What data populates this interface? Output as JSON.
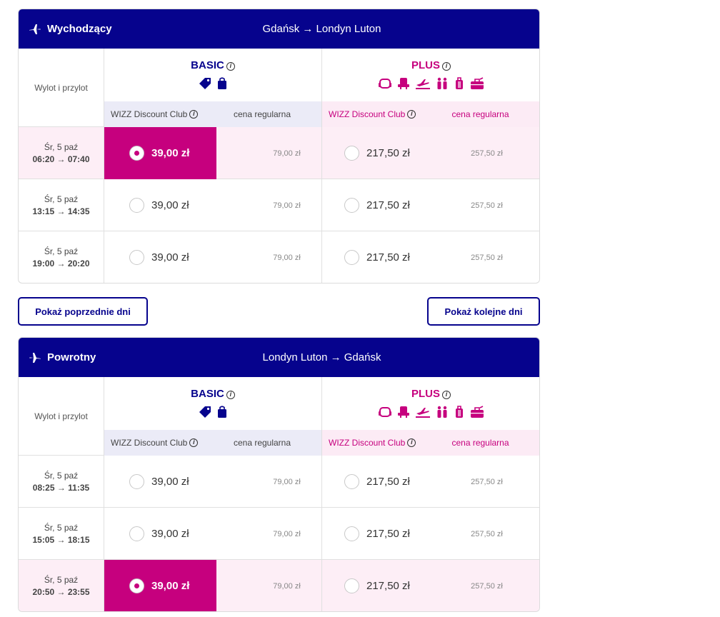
{
  "colors": {
    "brand_blue": "#06038d",
    "brand_pink": "#c6007e",
    "selected_row": "#fdeef6"
  },
  "buttons": {
    "prev_days": "Pokaż poprzednie dni",
    "next_days": "Pokaż kolejne dni"
  },
  "outbound": {
    "direction": "Wychodzący",
    "route": "Gdańsk → Londyn Luton",
    "col_label": "Wylot i przylot",
    "basic": {
      "title": "BASIC",
      "club": "WIZZ Discount Club",
      "regular": "cena regularna"
    },
    "plus": {
      "title": "PLUS",
      "club": "WIZZ Discount Club",
      "regular": "cena regularna"
    },
    "flights": [
      {
        "date": "Śr, 5 paź",
        "time": "06:20 → 07:40",
        "basic_club": "39,00 zł",
        "basic_regular": "79,00 zł",
        "plus_club": "217,50 zł",
        "plus_regular": "257,50 zł",
        "selected": true
      },
      {
        "date": "Śr, 5 paź",
        "time": "13:15 → 14:35",
        "basic_club": "39,00 zł",
        "basic_regular": "79,00 zł",
        "plus_club": "217,50 zł",
        "plus_regular": "257,50 zł",
        "selected": false
      },
      {
        "date": "Śr, 5 paź",
        "time": "19:00 → 20:20",
        "basic_club": "39,00 zł",
        "basic_regular": "79,00 zł",
        "plus_club": "217,50 zł",
        "plus_regular": "257,50 zł",
        "selected": false
      }
    ]
  },
  "return": {
    "direction": "Powrotny",
    "route": "Londyn Luton → Gdańsk",
    "col_label": "Wylot i przylot",
    "basic": {
      "title": "BASIC",
      "club": "WIZZ Discount Club",
      "regular": "cena regularna"
    },
    "plus": {
      "title": "PLUS",
      "club": "WIZZ Discount Club",
      "regular": "cena regularna"
    },
    "flights": [
      {
        "date": "Śr, 5 paź",
        "time": "08:25 → 11:35",
        "basic_club": "39,00 zł",
        "basic_regular": "79,00 zł",
        "plus_club": "217,50 zł",
        "plus_regular": "257,50 zł",
        "selected": false
      },
      {
        "date": "Śr, 5 paź",
        "time": "15:05 → 18:15",
        "basic_club": "39,00 zł",
        "basic_regular": "79,00 zł",
        "plus_club": "217,50 zł",
        "plus_regular": "257,50 zł",
        "selected": false
      },
      {
        "date": "Śr, 5 paź",
        "time": "20:50 → 23:55",
        "basic_club": "39,00 zł",
        "basic_regular": "79,00 zł",
        "plus_club": "217,50 zł",
        "plus_regular": "257,50 zł",
        "selected": true
      }
    ]
  },
  "icons": {
    "basic": [
      "price-tag-icon",
      "small-bag-icon"
    ],
    "plus": [
      "seat-icon",
      "seat-selection-icon",
      "priority-boarding-icon",
      "check-in-icon",
      "trolley-bag-icon",
      "checked-bag-icon"
    ]
  }
}
